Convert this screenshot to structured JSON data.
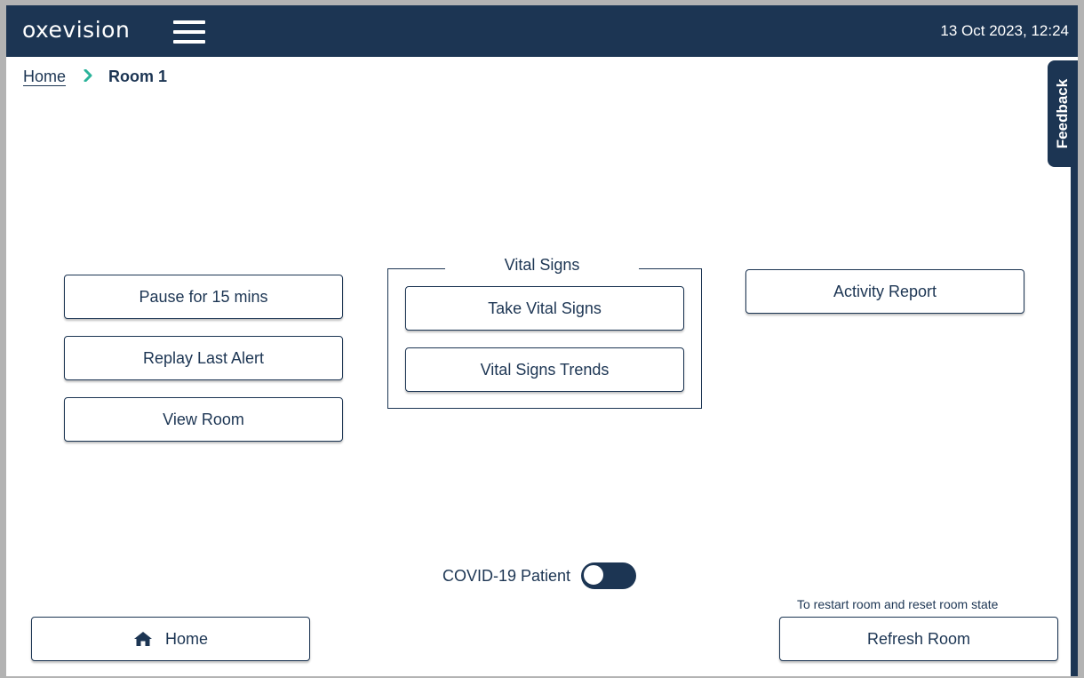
{
  "header": {
    "logo": "oxevision",
    "menu_icon": "hamburger-menu-icon",
    "datetime": "13 Oct 2023, 12:24"
  },
  "breadcrumb": {
    "home": "Home",
    "separator_icon": "chevron-right-icon",
    "current": "Room 1"
  },
  "feedback": {
    "label": "Feedback"
  },
  "actions": {
    "pause": "Pause for 15 mins",
    "replay": "Replay Last Alert",
    "view_room": "View Room",
    "activity_report": "Activity Report"
  },
  "vital_signs": {
    "title": "Vital Signs",
    "take": "Take Vital Signs",
    "trends": "Vital Signs Trends"
  },
  "covid": {
    "label": "COVID-19 Patient",
    "enabled": false
  },
  "footer": {
    "home": "Home",
    "home_icon": "home-icon",
    "refresh_hint": "To restart room and reset room state",
    "refresh": "Refresh Room"
  },
  "colors": {
    "primary": "#1c3553",
    "accent": "#2bb39a",
    "background": "#ffffff"
  }
}
